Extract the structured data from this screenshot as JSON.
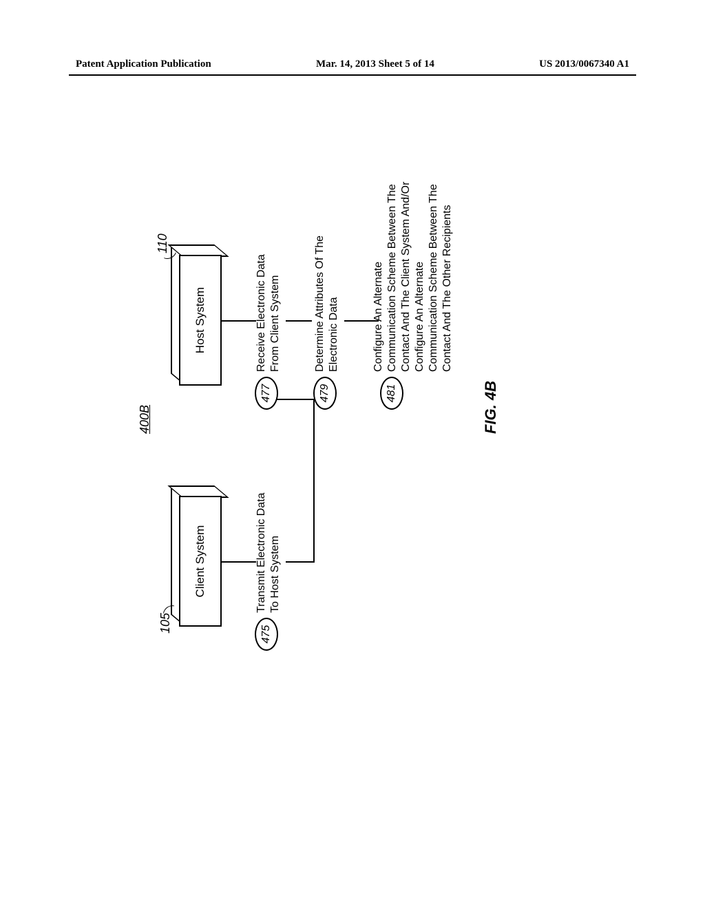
{
  "header": {
    "left": "Patent Application Publication",
    "center": "Mar. 14, 2013  Sheet 5 of 14",
    "right": "US 2013/0067340 A1"
  },
  "diagram": {
    "ref": "400B",
    "client_box": {
      "label": "Client System",
      "callout": "105"
    },
    "host_box": {
      "label": "Host System",
      "callout": "110"
    },
    "steps": {
      "s475": {
        "num": "475",
        "text": "Transmit Electronic Data\nTo Host System"
      },
      "s477": {
        "num": "477",
        "text": "Receive Electronic Data\nFrom Client System"
      },
      "s479": {
        "num": "479",
        "text": "Determine Attributes Of The\nElectronic Data"
      },
      "s481": {
        "num": "481",
        "text": "Configure An Alternate\nCommunication Scheme Between The\nContact And The Client System And/Or\nConfigure An Alternate\nCommunication Scheme Between The\nContact And The Other Recipients"
      }
    },
    "fig_caption": "FIG. 4B"
  }
}
